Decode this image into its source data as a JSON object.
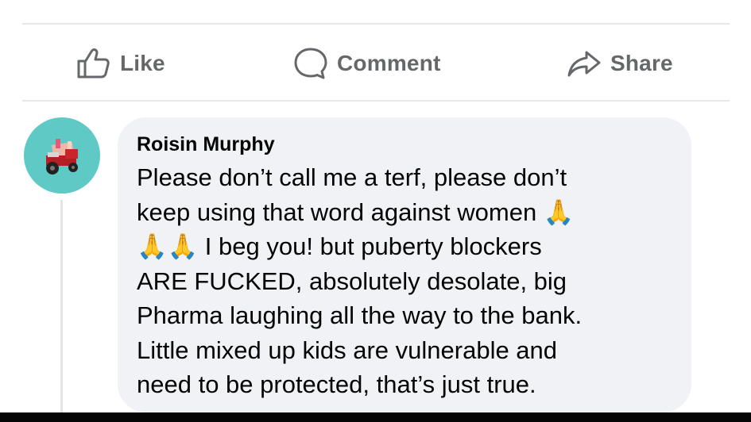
{
  "actions": {
    "like_label": "Like",
    "comment_label": "Comment",
    "share_label": "Share"
  },
  "comment": {
    "author": "Roisin Murphy",
    "lines": [
      "Please don’t call me a terf, please don’t",
      "keep using that word against women 🙏",
      "🙏🙏 I beg you! but puberty blockers",
      "ARE FUCKED, absolutely desolate, big",
      "Pharma laughing all the way to the bank.",
      "Little mixed up kids are vulnerable and",
      "need to be protected, that’s just true."
    ]
  },
  "colors": {
    "action_text": "#65676b",
    "bubble_bg": "#f0f2f5",
    "avatar_bg": "#5fc9c5",
    "divider": "#e6e7ea"
  },
  "icons": [
    "thumbs-up-icon",
    "comment-icon",
    "share-icon",
    "pray-emoji"
  ]
}
